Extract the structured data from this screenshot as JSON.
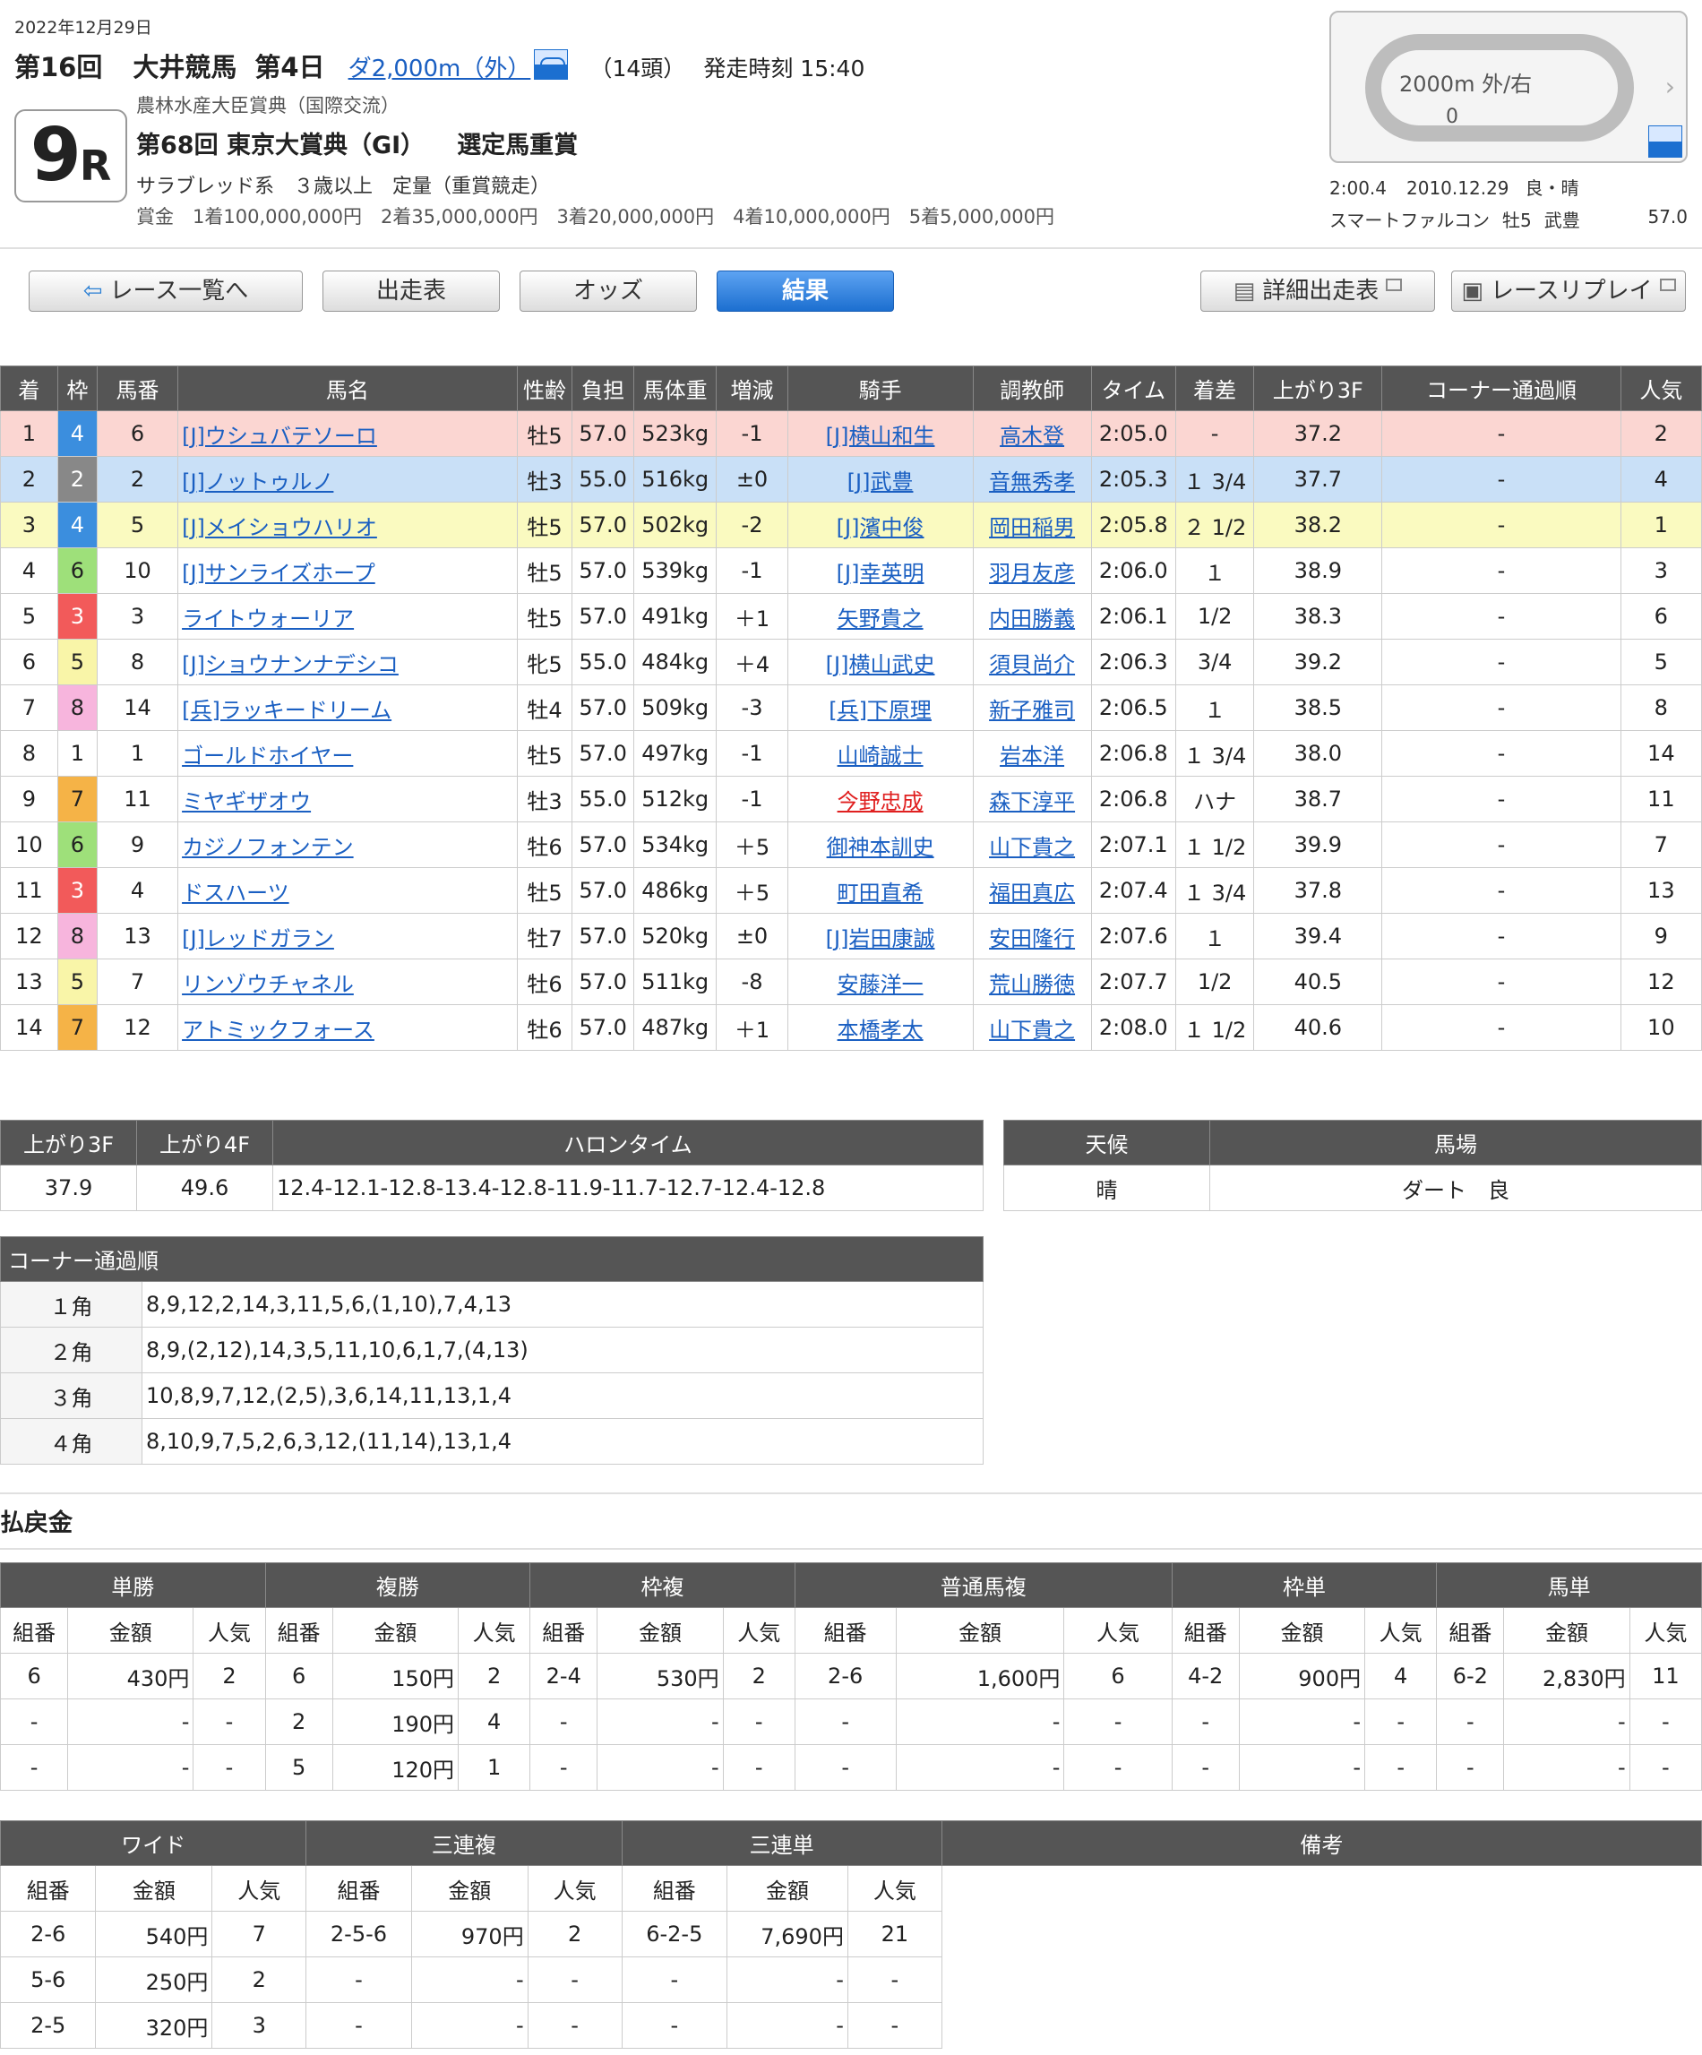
{
  "header": {
    "date": "2022年12月29日",
    "kai": "第16回",
    "venue": "大井競馬",
    "day": "第4日",
    "distance_link": "ダ2,000m（外）",
    "entries": "（14頭）",
    "start_time": "発走時刻 15:40",
    "race_no": "9",
    "race_suffix": "R",
    "sponsor": "農林水産大臣賞典（国際交流）",
    "race_name": "第68回 東京大賞典（GⅠ）",
    "race_note": "選定馬重賞",
    "conditions": "サラブレッド系　３歳以上　定量（重賞競走）",
    "prize": "賞金　1着100,000,000円　2着35,000,000円　3着20,000,000円　4着10,000,000円　5着5,000,000円"
  },
  "track": {
    "label": "2000m 外/右",
    "zero": "0",
    "arrow": "›",
    "record_time": "2:00.4",
    "record_date": "2010.12.29",
    "record_cond": "良・晴",
    "record_horse": "スマートファルコン",
    "record_sex": "牡5",
    "record_jockey": "武豊",
    "record_weight": "57.0"
  },
  "nav": {
    "back": "レース一覧へ",
    "entries": "出走表",
    "odds": "オッズ",
    "result": "結果",
    "detail": "詳細出走表",
    "replay": "レースリプレイ"
  },
  "results_headers": [
    "着",
    "枠",
    "馬番",
    "馬名",
    "性齢",
    "負担",
    "馬体重",
    "増減",
    "騎手",
    "調教師",
    "タイム",
    "着差",
    "上がり3F",
    "コーナー通過順",
    "人気"
  ],
  "results": [
    {
      "pos": "1",
      "waku": "4",
      "num": "6",
      "horse": "[J]ウシュバテソーロ",
      "sex": "牡5",
      "wt": "57.0",
      "bw": "523kg",
      "diff": "-1",
      "jockey": "[J]横山和生",
      "trainer": "高木登",
      "time": "2:05.0",
      "margin": "-",
      "f3": "37.2",
      "corner": "-",
      "pop": "2"
    },
    {
      "pos": "2",
      "waku": "2",
      "num": "2",
      "horse": "[J]ノットゥルノ",
      "sex": "牡3",
      "wt": "55.0",
      "bw": "516kg",
      "diff": "±0",
      "jockey": "[J]武豊",
      "trainer": "音無秀孝",
      "time": "2:05.3",
      "margin": "１ 3/4",
      "f3": "37.7",
      "corner": "-",
      "pop": "4"
    },
    {
      "pos": "3",
      "waku": "4",
      "num": "5",
      "horse": "[J]メイショウハリオ",
      "sex": "牡5",
      "wt": "57.0",
      "bw": "502kg",
      "diff": "-2",
      "jockey": "[J]濱中俊",
      "trainer": "岡田稲男",
      "time": "2:05.8",
      "margin": "２ 1/2",
      "f3": "38.2",
      "corner": "-",
      "pop": "1"
    },
    {
      "pos": "4",
      "waku": "6",
      "num": "10",
      "horse": "[J]サンライズホープ",
      "sex": "牡5",
      "wt": "57.0",
      "bw": "539kg",
      "diff": "-1",
      "jockey": "[J]幸英明",
      "trainer": "羽月友彦",
      "time": "2:06.0",
      "margin": "１",
      "f3": "38.9",
      "corner": "-",
      "pop": "3"
    },
    {
      "pos": "5",
      "waku": "3",
      "num": "3",
      "horse": "ライトウォーリア",
      "sex": "牡5",
      "wt": "57.0",
      "bw": "491kg",
      "diff": "＋1",
      "jockey": "矢野貴之",
      "trainer": "内田勝義",
      "time": "2:06.1",
      "margin": "1/2",
      "f3": "38.3",
      "corner": "-",
      "pop": "6"
    },
    {
      "pos": "6",
      "waku": "5",
      "num": "8",
      "horse": "[J]ショウナンナデシコ",
      "sex": "牝5",
      "wt": "55.0",
      "bw": "484kg",
      "diff": "＋4",
      "jockey": "[J]横山武史",
      "trainer": "須貝尚介",
      "time": "2:06.3",
      "margin": "3/4",
      "f3": "39.2",
      "corner": "-",
      "pop": "5"
    },
    {
      "pos": "7",
      "waku": "8",
      "num": "14",
      "horse": "[兵]ラッキードリーム",
      "sex": "牡4",
      "wt": "57.0",
      "bw": "509kg",
      "diff": "-3",
      "jockey": "[兵]下原理",
      "trainer": "新子雅司",
      "time": "2:06.5",
      "margin": "１",
      "f3": "38.5",
      "corner": "-",
      "pop": "8"
    },
    {
      "pos": "8",
      "waku": "1",
      "num": "1",
      "horse": "ゴールドホイヤー",
      "sex": "牡5",
      "wt": "57.0",
      "bw": "497kg",
      "diff": "-1",
      "jockey": "山崎誠士",
      "trainer": "岩本洋",
      "time": "2:06.8",
      "margin": "１ 3/4",
      "f3": "38.0",
      "corner": "-",
      "pop": "14"
    },
    {
      "pos": "9",
      "waku": "7",
      "num": "11",
      "horse": "ミヤギザオウ",
      "sex": "牡3",
      "wt": "55.0",
      "bw": "512kg",
      "diff": "-1",
      "jockey": "今野忠成",
      "jockey_red": true,
      "trainer": "森下淳平",
      "time": "2:06.8",
      "margin": "ハナ",
      "f3": "38.7",
      "corner": "-",
      "pop": "11"
    },
    {
      "pos": "10",
      "waku": "6",
      "num": "9",
      "horse": "カジノフォンテン",
      "sex": "牡6",
      "wt": "57.0",
      "bw": "534kg",
      "diff": "＋5",
      "jockey": "御神本訓史",
      "trainer": "山下貴之",
      "time": "2:07.1",
      "margin": "１ 1/2",
      "f3": "39.9",
      "corner": "-",
      "pop": "7"
    },
    {
      "pos": "11",
      "waku": "3",
      "num": "4",
      "horse": "ドスハーツ",
      "sex": "牡5",
      "wt": "57.0",
      "bw": "486kg",
      "diff": "＋5",
      "jockey": "町田直希",
      "trainer": "福田真広",
      "time": "2:07.4",
      "margin": "１ 3/4",
      "f3": "37.8",
      "corner": "-",
      "pop": "13"
    },
    {
      "pos": "12",
      "waku": "8",
      "num": "13",
      "horse": "[J]レッドガラン",
      "sex": "牡7",
      "wt": "57.0",
      "bw": "520kg",
      "diff": "±0",
      "jockey": "[J]岩田康誠",
      "trainer": "安田隆行",
      "time": "2:07.6",
      "margin": "１",
      "f3": "39.4",
      "corner": "-",
      "pop": "9"
    },
    {
      "pos": "13",
      "waku": "5",
      "num": "7",
      "horse": "リンゾウチャネル",
      "sex": "牡6",
      "wt": "57.0",
      "bw": "511kg",
      "diff": "-8",
      "jockey": "安藤洋一",
      "trainer": "荒山勝徳",
      "time": "2:07.7",
      "margin": "1/2",
      "f3": "40.5",
      "corner": "-",
      "pop": "12"
    },
    {
      "pos": "14",
      "waku": "7",
      "num": "12",
      "horse": "アトミックフォース",
      "sex": "牡6",
      "wt": "57.0",
      "bw": "487kg",
      "diff": "＋1",
      "jockey": "本橋孝太",
      "trainer": "山下貴之",
      "time": "2:08.0",
      "margin": "１ 1/2",
      "f3": "40.6",
      "corner": "-",
      "pop": "10"
    }
  ],
  "laps": {
    "h_f3": "上がり3F",
    "h_f4": "上がり4F",
    "h_lap": "ハロンタイム",
    "f3": "37.9",
    "f4": "49.6",
    "lap": "12.4-12.1-12.8-13.4-12.8-11.9-11.7-12.7-12.4-12.8"
  },
  "weather": {
    "h_weather": "天候",
    "h_track": "馬場",
    "weather": "晴",
    "track": "ダート　良"
  },
  "corners": {
    "title": "コーナー通過順",
    "rows": [
      {
        "label": "１角",
        "order": "8,9,12,2,14,3,11,5,6,(1,10),7,4,13"
      },
      {
        "label": "２角",
        "order": "8,9,(2,12),14,3,5,11,10,6,1,7,(4,13)"
      },
      {
        "label": "３角",
        "order": "10,8,9,7,12,(2,5),3,6,14,11,13,1,4"
      },
      {
        "label": "４角",
        "order": "8,10,9,7,5,2,6,3,12,(11,14),13,1,4"
      }
    ]
  },
  "payout_title": "払戻金",
  "payout1": {
    "groups": [
      "単勝",
      "複勝",
      "枠複",
      "普通馬複",
      "枠単",
      "馬単"
    ],
    "sub": [
      "組番",
      "金額",
      "人気"
    ],
    "rows": [
      [
        "6",
        "430円",
        "2",
        "6",
        "150円",
        "2",
        "2-4",
        "530円",
        "2",
        "2-6",
        "1,600円",
        "6",
        "4-2",
        "900円",
        "4",
        "6-2",
        "2,830円",
        "11"
      ],
      [
        "-",
        "-",
        "-",
        "2",
        "190円",
        "4",
        "-",
        "-",
        "-",
        "-",
        "-",
        "-",
        "-",
        "-",
        "-",
        "-",
        "-",
        "-"
      ],
      [
        "-",
        "-",
        "-",
        "5",
        "120円",
        "1",
        "-",
        "-",
        "-",
        "-",
        "-",
        "-",
        "-",
        "-",
        "-",
        "-",
        "-",
        "-"
      ]
    ]
  },
  "payout2": {
    "groups": [
      "ワイド",
      "三連複",
      "三連単",
      "備考"
    ],
    "sub": [
      "組番",
      "金額",
      "人気"
    ],
    "rows": [
      [
        "2-6",
        "540円",
        "7",
        "2-5-6",
        "970円",
        "2",
        "6-2-5",
        "7,690円",
        "21"
      ],
      [
        "5-6",
        "250円",
        "2",
        "-",
        "-",
        "-",
        "-",
        "-",
        "-"
      ],
      [
        "2-5",
        "320円",
        "3",
        "-",
        "-",
        "-",
        "-",
        "-",
        "-"
      ]
    ]
  }
}
